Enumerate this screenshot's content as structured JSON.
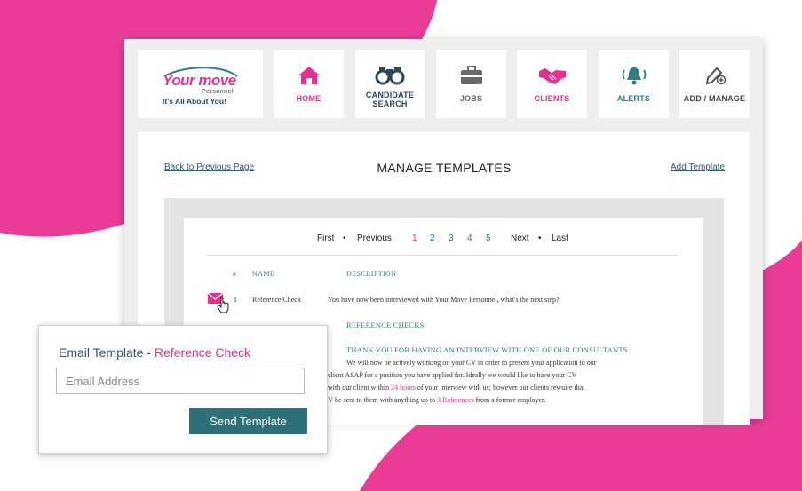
{
  "logo": {
    "brand": "Your move",
    "sub": "Personnel",
    "tagline": "It's All About You!"
  },
  "nav": {
    "home": "HOME",
    "candidate_search": "CANDIDATE\nSEARCH",
    "candidate_line1": "CANDIDATE",
    "candidate_line2": "SEARCH",
    "jobs": "JOBS",
    "clients": "CLIENTS",
    "alerts": "ALERTS",
    "add_manage": "ADD / MANAGE"
  },
  "colors": {
    "pink": "#e5308f",
    "teal": "#2e7078",
    "dark": "#2f4858"
  },
  "page": {
    "back_link": "Back to Previous Page",
    "title": "MANAGE TEMPLATES",
    "add_link": "Add Template"
  },
  "pagination": {
    "first": "First",
    "previous": "Previous",
    "pages": [
      "1",
      "2",
      "3",
      "4",
      "5"
    ],
    "active": "1",
    "next": "Next",
    "last": "Last"
  },
  "table": {
    "headers": {
      "num": "#",
      "name": "NAME",
      "description": "DESCRIPTION"
    },
    "rows": [
      {
        "num": "1",
        "name": "Reference Check",
        "description": "You have now been interviewed with Your Move Personnel, what's the next step?"
      }
    ]
  },
  "template_body": {
    "heading": "REFERENCE CHECKS",
    "subheading": "THANK YOU FOR HAVING AN INTERVIEW WITH ONE OF OUR CONSULTANTS",
    "line1": "We will now be actively working on your CV in order to present your application to our",
    "line2": "client ASAP for a position you have applied for.  Ideally we would like to have your CV",
    "line3_a": "with our client within ",
    "line3_hl": "24 hours",
    "line3_b": " of your interview with us; however our clients rewuire that",
    "line4_a": "CV be sent to them with anything up to ",
    "line4_hl": "3 References",
    "line4_b": " from a former employer."
  },
  "popup": {
    "title_prefix": "Email Template - ",
    "title_name": "Reference Check",
    "email_placeholder": "Email Address",
    "send_label": "Send Template"
  }
}
